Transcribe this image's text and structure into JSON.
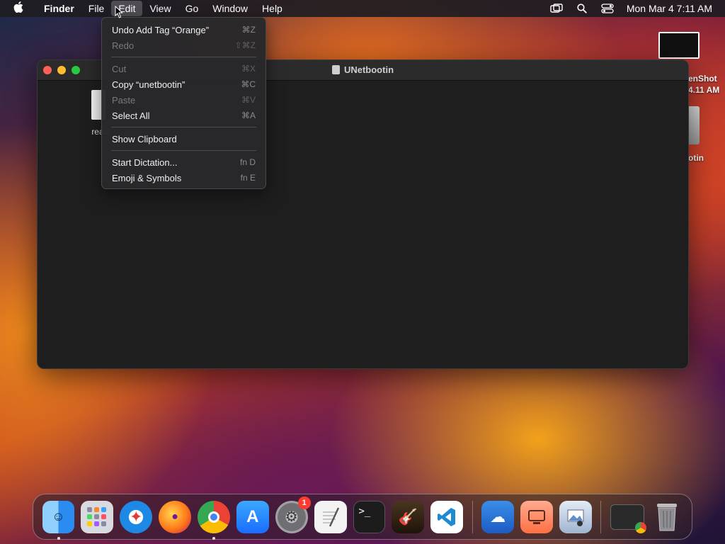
{
  "menubar": {
    "apple_icon": "apple-logo-icon",
    "items": [
      "Finder",
      "File",
      "Edit",
      "View",
      "Go",
      "Window",
      "Help"
    ],
    "active_menu": "Edit",
    "clock": "Mon Mar 4  7:11 AM",
    "status_icons": [
      "screen-mirroring-icon",
      "search-icon",
      "control-center-icon"
    ]
  },
  "edit_menu": {
    "items": [
      {
        "label": "Undo Add Tag “Orange”",
        "shortcut": "⌘Z",
        "enabled": true
      },
      {
        "label": "Redo",
        "shortcut": "⇧⌘Z",
        "enabled": false
      },
      {
        "label": "Cut",
        "shortcut": "⌘X",
        "enabled": false
      },
      {
        "label": "Copy “unetbootin”",
        "shortcut": "⌘C",
        "enabled": true
      },
      {
        "label": "Paste",
        "shortcut": "⌘V",
        "enabled": false
      },
      {
        "label": "Select All",
        "shortcut": "⌘A",
        "enabled": true
      },
      {
        "label": "Show Clipboard",
        "shortcut": "",
        "enabled": true
      },
      {
        "label": "Start Dictation...",
        "shortcut": "fn D",
        "enabled": true
      },
      {
        "label": "Emoji & Symbols",
        "shortcut": "fn E",
        "enabled": true
      }
    ]
  },
  "window": {
    "title": "UNetbootin",
    "file_label": "readı"
  },
  "desktop": {
    "screenshot_label_1": "enShot",
    "screenshot_label_2": "4.11 AM",
    "drive_label": "otin"
  },
  "dock": {
    "apps": [
      {
        "name": "finder",
        "color": "#2a8cf0",
        "running": true
      },
      {
        "name": "launchpad",
        "color": "#d9d9e0",
        "running": false
      },
      {
        "name": "safari",
        "color": "#1e88e5",
        "running": false
      },
      {
        "name": "firefox",
        "color": "#ff7a18",
        "running": false
      },
      {
        "name": "chrome",
        "color": "#ffffff",
        "running": true
      },
      {
        "name": "app-store",
        "color": "#1a8cff",
        "running": false
      },
      {
        "name": "system-settings",
        "color": "#8a8a8e",
        "running": false,
        "badge": "1"
      },
      {
        "name": "textedit",
        "color": "#f3f3f3",
        "running": false
      },
      {
        "name": "terminal",
        "color": "#1c1c1c",
        "running": false
      },
      {
        "name": "garageband",
        "color": "#3a2a1a",
        "running": false
      },
      {
        "name": "vscode",
        "color": "#ffffff",
        "running": false
      }
    ],
    "apps2": [
      {
        "name": "weather",
        "color": "#2f7ddb"
      },
      {
        "name": "screen-sharing",
        "color": "#ff8a65"
      },
      {
        "name": "preview",
        "color": "#cfd8e6"
      }
    ],
    "apps3": [
      {
        "name": "chrome-window",
        "color": "#2a2a2a"
      },
      {
        "name": "trash",
        "color": "#9a9a9a"
      }
    ]
  }
}
